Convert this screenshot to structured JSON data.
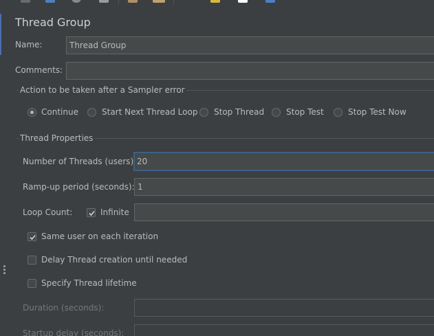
{
  "panel": {
    "title": "Thread Group"
  },
  "name_field": {
    "label": "Name:",
    "value": "Thread Group"
  },
  "comments_field": {
    "label": "Comments:",
    "value": ""
  },
  "sampler_error": {
    "title": "Action to be taken after a Sampler error",
    "options": [
      {
        "label": "Continue",
        "selected": true
      },
      {
        "label": "Start Next Thread Loop",
        "selected": false
      },
      {
        "label": "Stop Thread",
        "selected": false
      },
      {
        "label": "Stop Test",
        "selected": false
      },
      {
        "label": "Stop Test Now",
        "selected": false
      }
    ]
  },
  "thread_properties": {
    "title": "Thread Properties",
    "num_threads": {
      "label": "Number of Threads (users):",
      "value": "20"
    },
    "ramp_up": {
      "label": "Ramp-up period (seconds):",
      "value": "1"
    },
    "loop_count": {
      "label": "Loop Count:",
      "infinite_label": "Infinite",
      "infinite_checked": true,
      "value": ""
    },
    "same_user": {
      "label": "Same user on each iteration",
      "checked": true
    },
    "delay_creation": {
      "label": "Delay Thread creation until needed",
      "checked": false
    },
    "specify_lifetime": {
      "label": "Specify Thread lifetime",
      "checked": false
    },
    "duration": {
      "label": "Duration (seconds):",
      "value": ""
    },
    "startup_delay": {
      "label": "Startup delay (seconds):",
      "value": ""
    }
  },
  "colors": {
    "background": "#3c3f41",
    "field_bg": "#45494a",
    "focus_border": "#3d6185",
    "text": "#bbbbbb"
  }
}
